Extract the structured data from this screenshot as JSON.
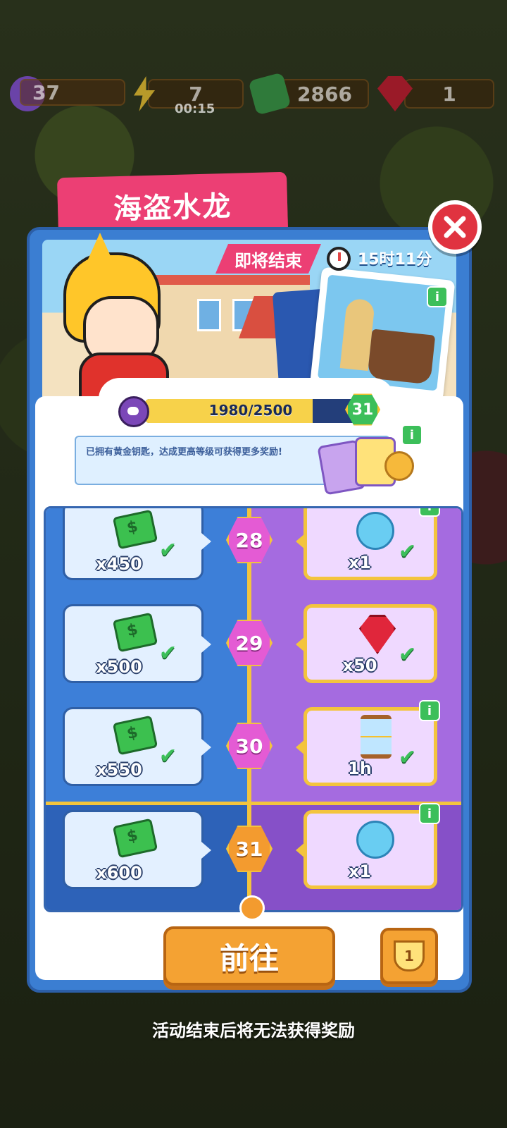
{
  "hud": {
    "level": "37",
    "energy": "7",
    "energy_timer": "00:15",
    "cash": "2866",
    "gems": "1"
  },
  "event": {
    "title": "海盗水龙",
    "ending_label": "即将结束",
    "time_left": "15时11分",
    "progress_text": "1980/2500",
    "progress_fraction": 0.792,
    "current_level": "31",
    "notice": "已拥有黄金钥匙，达成更高等级可获得更多奖励!",
    "go_button": "前往",
    "trophy_rank": "1",
    "footer_note": "活动结束后将无法获得奖励"
  },
  "rewards": [
    {
      "level": "28",
      "free_amount": "x450",
      "premium_icon": "scissor-icon",
      "premium_amount": "x1"
    },
    {
      "level": "29",
      "free_amount": "x500",
      "premium_icon": "gem-icon",
      "premium_amount": "x50"
    },
    {
      "level": "30",
      "free_amount": "x550",
      "premium_icon": "hourglass-icon",
      "premium_amount": "1h"
    },
    {
      "level": "31",
      "free_amount": "x600",
      "premium_icon": "scissor-icon",
      "premium_amount": "x1"
    }
  ],
  "info_mark": "i",
  "check_mark": "✔",
  "close_mark": "✕",
  "colors": {
    "accent_pink": "#ec3f74",
    "panel_blue": "#3b7ed2",
    "premium_purple": "#a56be0",
    "gold": "#f3c43d",
    "go_orange": "#f4a233"
  }
}
